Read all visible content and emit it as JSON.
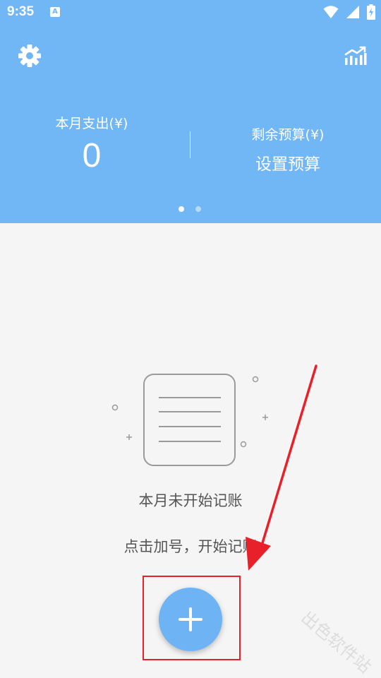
{
  "status_bar": {
    "time": "9:35",
    "notification_icon": "A",
    "icons": [
      "wifi-icon",
      "signal-icon",
      "battery-charging-icon"
    ]
  },
  "header": {
    "settings_icon": "gear-icon",
    "stats_icon": "chart-trend-icon",
    "monthly_expense_label": "本月支出(¥)",
    "monthly_expense_value": "0",
    "remaining_budget_label": "剩余预算(¥)",
    "set_budget_link": "设置预算",
    "pager": {
      "count": 2,
      "active_index": 0
    }
  },
  "empty_state": {
    "illustration_icon": "empty-ledger-icon",
    "title": "本月未开始记账",
    "subtitle": "点击加号，开始记账"
  },
  "fab": {
    "icon": "plus-icon"
  },
  "annotation": {
    "color": "#e8202a"
  },
  "watermark": "出色软件站",
  "colors": {
    "primary": "#71b6f5",
    "fab": "#6eb4f5",
    "background": "#f5f5f5"
  }
}
